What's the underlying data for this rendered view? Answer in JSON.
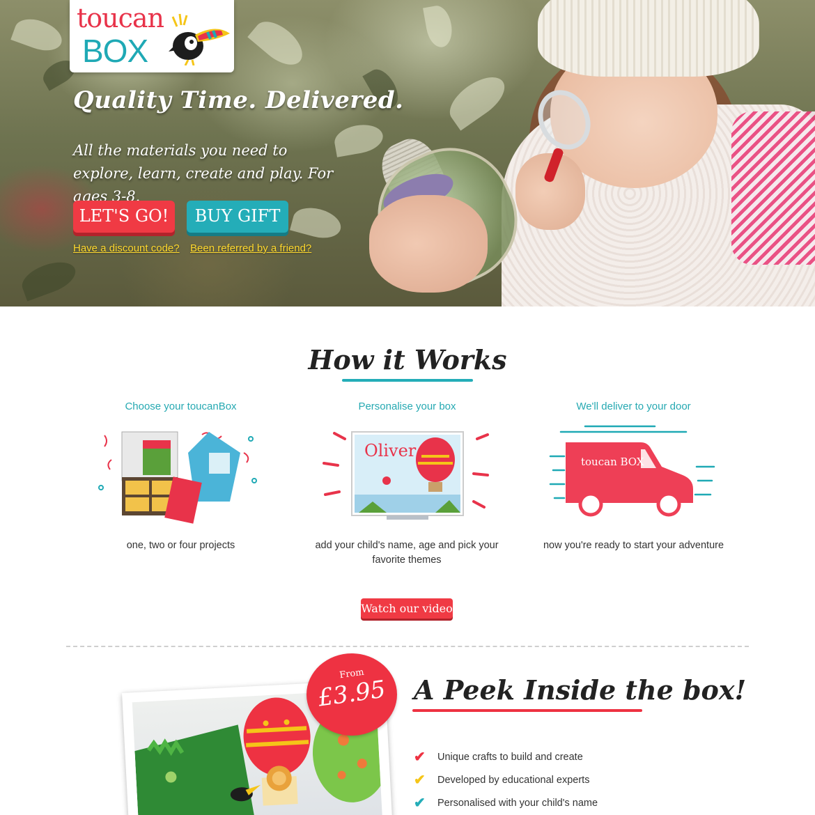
{
  "brand": {
    "logo_line1": "toucan",
    "logo_line2": "BOX",
    "colors": {
      "red": "#f03a44",
      "teal": "#24adb8",
      "yellow": "#ffd92e"
    }
  },
  "hero": {
    "title": "Quality Time. Delivered.",
    "subtitle": "All the materials you need to explore, learn, create and play. For ages 3-8.",
    "primary_button": "LET'S GO!",
    "secondary_button": "BUY GIFT",
    "discount_link": "Have a discount code?",
    "referral_link": "Been referred by a friend?"
  },
  "how_it_works": {
    "title": "How it Works",
    "steps": [
      {
        "title": "Choose your toucanBox",
        "description": "one, two or four projects",
        "icon": "box-icon"
      },
      {
        "title": "Personalise your box",
        "description": "add your child's name, age and pick your favorite themes",
        "icon": "personalised-card-icon",
        "card_name": "Oliver"
      },
      {
        "title": "We'll deliver to your door",
        "description": "now you're ready to start your adventure",
        "icon": "delivery-van-icon",
        "van_text": "toucan BOX"
      }
    ],
    "video_button": "Watch our video"
  },
  "peek": {
    "title": "A Peek Inside the box!",
    "price_from": "From",
    "price": "£3.95",
    "features": [
      {
        "text": "Unique crafts to build and create",
        "tick_color": "#ee3242"
      },
      {
        "text": "Developed by educational experts",
        "tick_color": "#f5c518"
      },
      {
        "text": "Personalised with your child's name",
        "tick_color": "#24adb8"
      }
    ]
  }
}
